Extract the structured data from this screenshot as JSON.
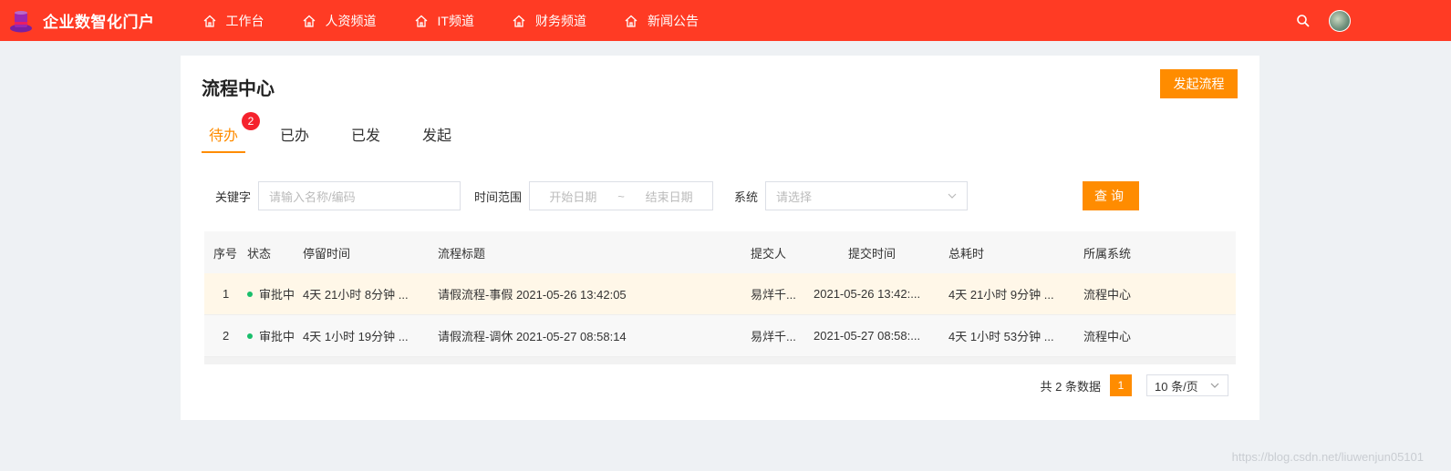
{
  "header": {
    "app_title": "企业数智化门户",
    "nav": [
      {
        "label": "工作台",
        "icon": "home-icon"
      },
      {
        "label": "人资频道",
        "icon": "home-icon"
      },
      {
        "label": "IT频道",
        "icon": "home-icon"
      },
      {
        "label": "财务频道",
        "icon": "home-icon"
      },
      {
        "label": "新闻公告",
        "icon": "home-icon"
      }
    ],
    "search_icon": "search-icon",
    "avatar_icon": "avatar"
  },
  "panel": {
    "title": "流程中心",
    "start_button": "发起流程",
    "tabs": [
      {
        "label": "待办",
        "badge": "2",
        "active": true
      },
      {
        "label": "已办"
      },
      {
        "label": "已发"
      },
      {
        "label": "发起"
      }
    ]
  },
  "filters": {
    "keyword_label": "关键字",
    "keyword_placeholder": "请输入名称/编码",
    "time_label": "时间范围",
    "start_placeholder": "开始日期",
    "range_sep": "~",
    "end_placeholder": "结束日期",
    "system_label": "系统",
    "system_placeholder": "请选择",
    "query_button": "查询"
  },
  "table": {
    "headers": [
      "序号",
      "状态",
      "停留时间",
      "流程标题",
      "提交人",
      "提交时间",
      "总耗时",
      "所属系统"
    ],
    "rows": [
      {
        "index": "1",
        "status": "审批中",
        "stay": "4天 21小时 8分钟 ...",
        "title": "请假流程-事假 2021-05-26 13:42:05",
        "submitter": "易烊千...",
        "submit_time": "2021-05-26 13:42:...",
        "total": "4天 21小时 9分钟 ...",
        "system": "流程中心"
      },
      {
        "index": "2",
        "status": "审批中",
        "stay": "4天 1小时 19分钟 ...",
        "title": "请假流程-调休 2021-05-27 08:58:14",
        "submitter": "易烊千...",
        "submit_time": "2021-05-27 08:58:...",
        "total": "4天 1小时 53分钟 ...",
        "system": "流程中心"
      }
    ]
  },
  "pagination": {
    "total_text": "共 2 条数据",
    "current_page": "1",
    "page_size": "10 条/页"
  },
  "watermark": "https://blog.csdn.net/liuwenjun05101",
  "colors": {
    "header_bg": "#ff3b24",
    "accent": "#ff8c00",
    "badge": "#f5222d",
    "status_dot": "#19be6b",
    "highlight_row": "#fff7e8"
  }
}
